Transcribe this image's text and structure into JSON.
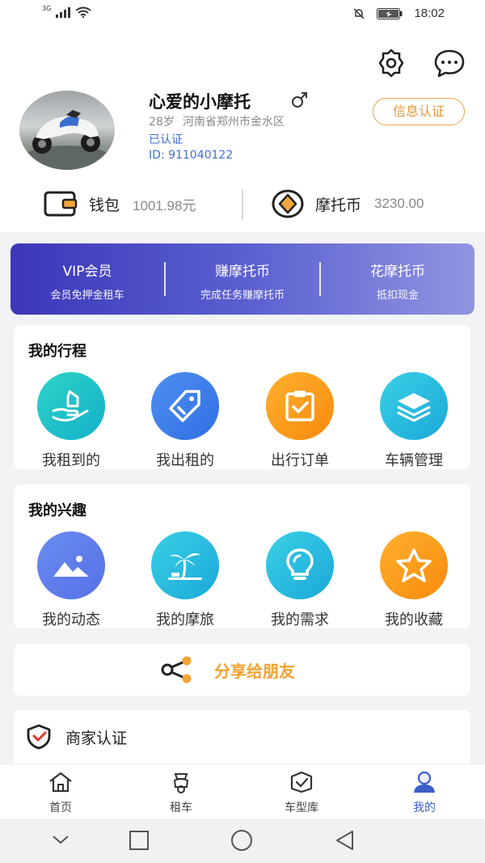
{
  "status_bar": {
    "network": "3G",
    "time": "18:02"
  },
  "profile": {
    "name": "心爱的小摩托",
    "gender_symbol": "♂",
    "age": "28岁",
    "location": "河南省郑州市金水区",
    "verified": "已认证",
    "id": "ID: 911040122",
    "auth_button": "信息认证"
  },
  "wallet": {
    "wallet_label": "钱包",
    "wallet_value": "1001.98元",
    "coin_label": "摩托币",
    "coin_value": "3230.00"
  },
  "vip_banner": [
    {
      "title": "VIP会员",
      "subtitle": "会员免押金租车"
    },
    {
      "title": "赚摩托币",
      "subtitle": "完成任务赚摩托币"
    },
    {
      "title": "花摩托币",
      "subtitle": "抵扣现金"
    }
  ],
  "trips": {
    "title": "我的行程",
    "items": [
      {
        "label": "我租到的",
        "icon": "hand-house-icon"
      },
      {
        "label": "我出租的",
        "icon": "tag-icon"
      },
      {
        "label": "出行订单",
        "icon": "clipboard-check-icon"
      },
      {
        "label": "车辆管理",
        "icon": "layers-icon"
      }
    ]
  },
  "interests": {
    "title": "我的兴趣",
    "items": [
      {
        "label": "我的动态",
        "icon": "image-icon"
      },
      {
        "label": "我的摩旅",
        "icon": "palm-tree-icon"
      },
      {
        "label": "我的需求",
        "icon": "lightbulb-icon"
      },
      {
        "label": "我的收藏",
        "icon": "star-icon"
      }
    ]
  },
  "share": {
    "label": "分享给朋友"
  },
  "merchant": {
    "label": "商家认证"
  },
  "tabs": [
    {
      "label": "首页",
      "icon": "home-icon"
    },
    {
      "label": "租车",
      "icon": "scooter-icon"
    },
    {
      "label": "车型库",
      "icon": "box-check-icon"
    },
    {
      "label": "我的",
      "icon": "user-icon"
    }
  ],
  "colors": {
    "accent_blue": "#3d5ec8",
    "accent_orange": "#f3a232",
    "teal_gradient": [
      "#2fd3c8",
      "#12b0c9"
    ],
    "blue_gradient": [
      "#4f8ff0",
      "#2f6fe3"
    ],
    "orange_gradient": [
      "#ffb02e",
      "#f78a0d"
    ],
    "violet_gradient": [
      "#6a8cf0",
      "#5670e6"
    ],
    "cyan_gradient": [
      "#3ad0e6",
      "#1ba8d8"
    ]
  }
}
